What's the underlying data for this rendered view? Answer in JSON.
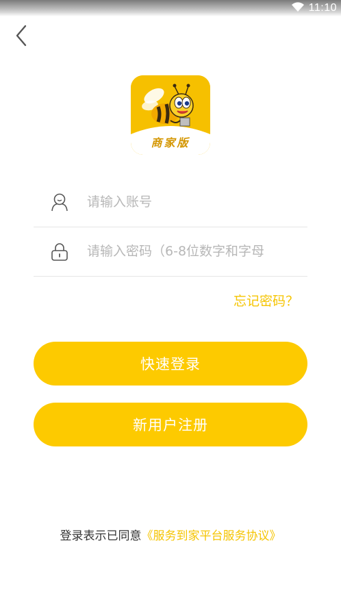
{
  "status_bar": {
    "time": "11:10",
    "wifi_icon": "wifi-icon"
  },
  "nav": {
    "back_icon": "chevron-left-icon"
  },
  "logo": {
    "text": "商家版",
    "icon": "bee-logo"
  },
  "form": {
    "account_placeholder": "请输入账号",
    "account_value": "",
    "account_icon": "user-icon",
    "password_placeholder": "请输入密码（6-8位数字和字母",
    "password_value": "",
    "password_icon": "lock-icon"
  },
  "forgot_label": "忘记密码？",
  "buttons": {
    "login": "快速登录",
    "register": "新用户注册"
  },
  "agreement": {
    "prefix": "登录表示已同意",
    "link": "《服务到家平台服务协议》"
  },
  "colors": {
    "accent": "#fdca00",
    "link": "#f5c400",
    "placeholder": "#b7b7b7"
  }
}
